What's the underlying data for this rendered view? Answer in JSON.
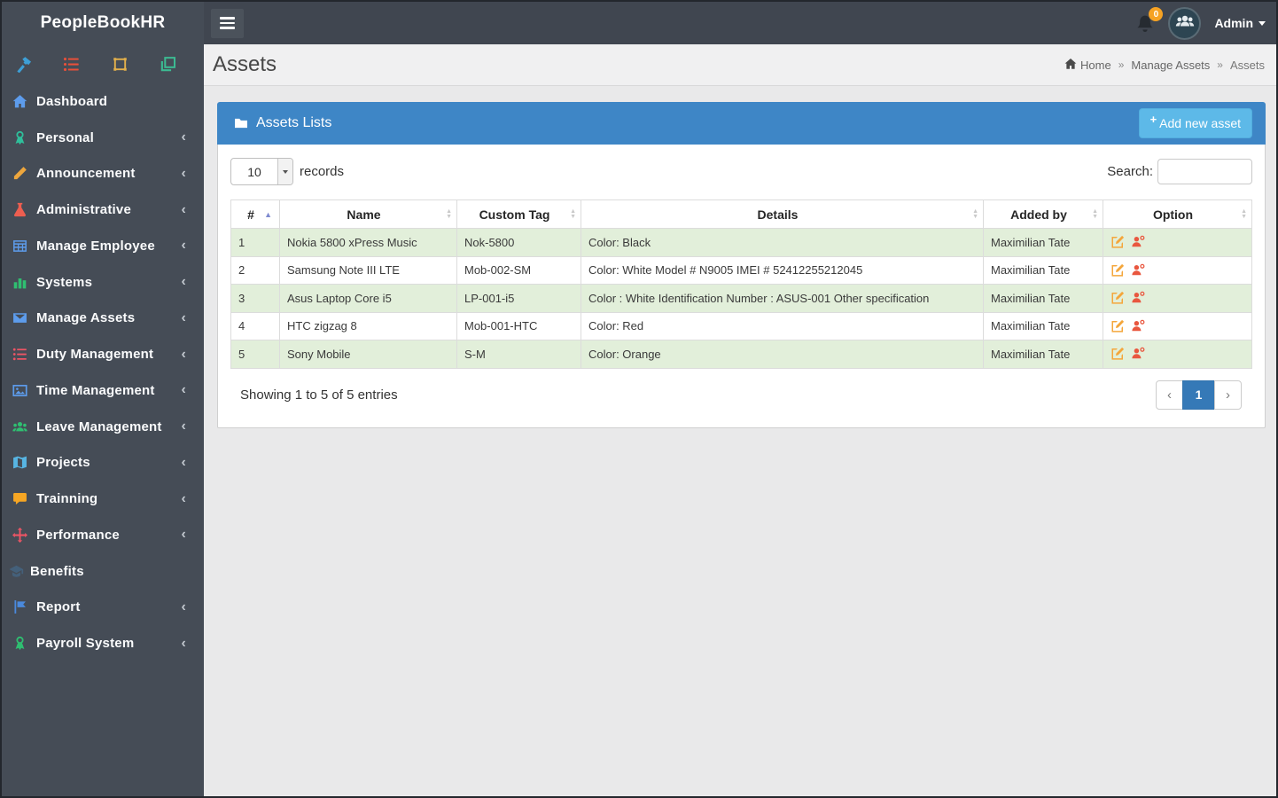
{
  "app": {
    "title": "PeopleBookHR"
  },
  "topbar": {
    "notification_badge": "0",
    "user_label": "Admin"
  },
  "sidebar": {
    "quick_icons": [
      {
        "name": "hammer-icon",
        "color": "#3d9fd6"
      },
      {
        "name": "bullet-list-icon",
        "color": "#e8503a"
      },
      {
        "name": "crop-icon",
        "color": "#e3b04b"
      },
      {
        "name": "layers-icon",
        "color": "#3cba92"
      }
    ],
    "items": [
      {
        "label": "Dashboard",
        "icon": "home-icon",
        "color": "#5d9cec",
        "chevron": false
      },
      {
        "label": "Personal",
        "icon": "medal-icon",
        "color": "#2fbf9b",
        "chevron": true
      },
      {
        "label": "Announcement",
        "icon": "pencil-icon",
        "color": "#eda63d",
        "chevron": true
      },
      {
        "label": "Administrative",
        "icon": "flask-icon",
        "color": "#ed5e50",
        "chevron": true
      },
      {
        "label": "Manage Employee",
        "icon": "table-icon",
        "color": "#5d9cec",
        "chevron": true
      },
      {
        "label": "Systems",
        "icon": "bar-chart-icon",
        "color": "#2fbf71",
        "chevron": true
      },
      {
        "label": "Manage Assets",
        "icon": "envelope-icon",
        "color": "#5d9cec",
        "chevron": true
      },
      {
        "label": "Duty Management",
        "icon": "bullet-list-icon",
        "color": "#ed5565",
        "chevron": true
      },
      {
        "label": "Time Management",
        "icon": "image-icon",
        "color": "#5d9cec",
        "chevron": true
      },
      {
        "label": "Leave Management",
        "icon": "users-icon",
        "color": "#2fbf71",
        "chevron": true
      },
      {
        "label": "Projects",
        "icon": "map-icon",
        "color": "#57b5e3",
        "chevron": true
      },
      {
        "label": "Trainning",
        "icon": "comment-icon",
        "color": "#f6a623",
        "chevron": true
      },
      {
        "label": "Performance",
        "icon": "move-icon",
        "color": "#ed5565",
        "chevron": true
      },
      {
        "label": "Benefits",
        "icon": "cap-icon",
        "color": "#44607a",
        "chevron": false,
        "compact": true
      },
      {
        "label": "Report",
        "icon": "flag-icon",
        "color": "#4a89dc",
        "chevron": true
      },
      {
        "label": "Payroll System",
        "icon": "medal-icon",
        "color": "#2fbf71",
        "chevron": true
      }
    ]
  },
  "page": {
    "title": "Assets",
    "breadcrumb": [
      "Home",
      "Manage Assets",
      "Assets"
    ],
    "breadcrumb_separator": "»"
  },
  "panel": {
    "title": "Assets Lists",
    "add_button": "Add new asset",
    "records_value": "10",
    "records_label": "records",
    "search_label": "Search:",
    "search_value": ""
  },
  "table": {
    "columns": [
      "#",
      "Name",
      "Custom Tag",
      "Details",
      "Added by",
      "Option"
    ],
    "option_icons": [
      "edit-icon",
      "user-badge-icon"
    ],
    "rows": [
      {
        "num": "1",
        "name": "Nokia 5800 xPress Music",
        "tag": "Nok-5800",
        "details": "Color: Black",
        "added_by": "Maximilian Tate"
      },
      {
        "num": "2",
        "name": "Samsung Note III LTE",
        "tag": "Mob-002-SM",
        "details": "Color: White Model # N9005 IMEI # 52412255212045",
        "added_by": "Maximilian Tate"
      },
      {
        "num": "3",
        "name": "Asus Laptop Core i5",
        "tag": "LP-001-i5",
        "details": "Color : White Identification Number : ASUS-001 Other specification",
        "added_by": "Maximilian Tate"
      },
      {
        "num": "4",
        "name": "HTC zigzag 8",
        "tag": "Mob-001-HTC",
        "details": "Color: Red",
        "added_by": "Maximilian Tate"
      },
      {
        "num": "5",
        "name": "Sony Mobile",
        "tag": "S-M",
        "details": "Color: Orange",
        "added_by": "Maximilian Tate"
      }
    ],
    "footer": "Showing 1 to 5 of 5 entries",
    "pagination": {
      "prev": "‹",
      "current": "1",
      "next": "›"
    }
  },
  "colors": {
    "sidebar_bg": "#454c56",
    "topbar_bg": "#404650",
    "panel_blue": "#3e86c6",
    "add_button": "#5db9e8",
    "row_stripe": "#e2efda",
    "pagination_active": "#3579b7",
    "badge": "#f6a223",
    "edit_icon": "#f4a63b",
    "user_icon": "#e9573f",
    "sort_active_arrow": "#7f8bd0"
  }
}
